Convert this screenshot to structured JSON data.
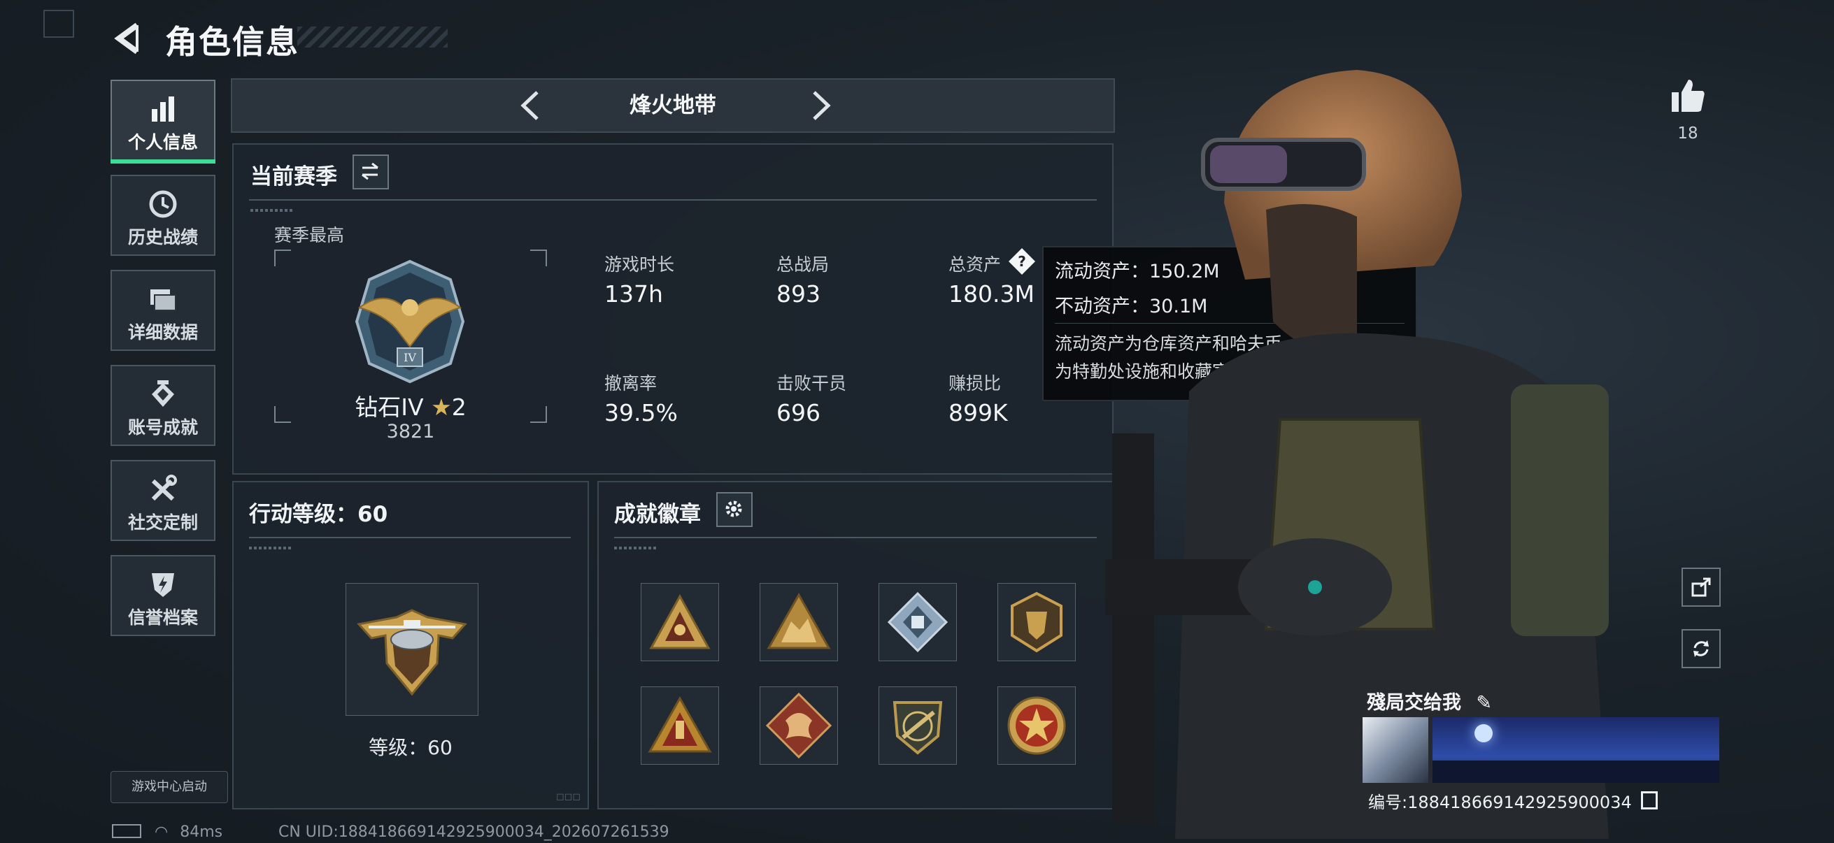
{
  "header": {
    "title": "角色信息"
  },
  "sidebar": {
    "items": [
      {
        "label": "个人信息",
        "icon": "bar-chart-icon",
        "active": true
      },
      {
        "label": "历史战绩",
        "icon": "history-clock-icon"
      },
      {
        "label": "详细数据",
        "icon": "folder-icon"
      },
      {
        "label": "账号成就",
        "icon": "achievement-icon"
      },
      {
        "label": "社交定制",
        "icon": "tools-icon"
      },
      {
        "label": "信誉档案",
        "icon": "credit-shield-icon"
      }
    ],
    "launch_badge": "游戏中心启动"
  },
  "mode": {
    "name": "烽火地带"
  },
  "season": {
    "title": "当前赛季",
    "best_label": "赛季最高",
    "rank_name": "钻石IV",
    "rank_stars": "2",
    "rank_points": "3821",
    "stats": [
      {
        "label": "游戏时长",
        "value": "137h"
      },
      {
        "label": "总战局",
        "value": "893"
      },
      {
        "label": "总资产",
        "value": "180.3M"
      },
      {
        "label": "撤离率",
        "value": "39.5%"
      },
      {
        "label": "击败干员",
        "value": "696"
      },
      {
        "label": "赚损比",
        "value": "899K"
      }
    ]
  },
  "tooltip": {
    "liquid": "流动资产：150.2M",
    "fixed": "不动资产：30.1M",
    "desc_line1": "流动资产为仓库资产和哈夫币，不动资产",
    "desc_line2": "为特勤处设施和收藏室设施"
  },
  "action": {
    "title": "行动等级：60",
    "level_text": "等级：60"
  },
  "badges": {
    "title": "成就徽章",
    "items": [
      "badge-1",
      "badge-2",
      "badge-3",
      "badge-4",
      "badge-5",
      "badge-6",
      "badge-7",
      "badge-8"
    ]
  },
  "profile": {
    "likes": "18",
    "nickname": "殘局交给我",
    "id_number": "编号:18841866914292590003​4"
  },
  "status": {
    "ping": "84ms",
    "uid": "CN UID:18841866914292590003​4_202607261539"
  },
  "colors": {
    "accent_green": "#3ddc97",
    "gold": "#c9a04f",
    "panel_bg": "#1c242c"
  }
}
